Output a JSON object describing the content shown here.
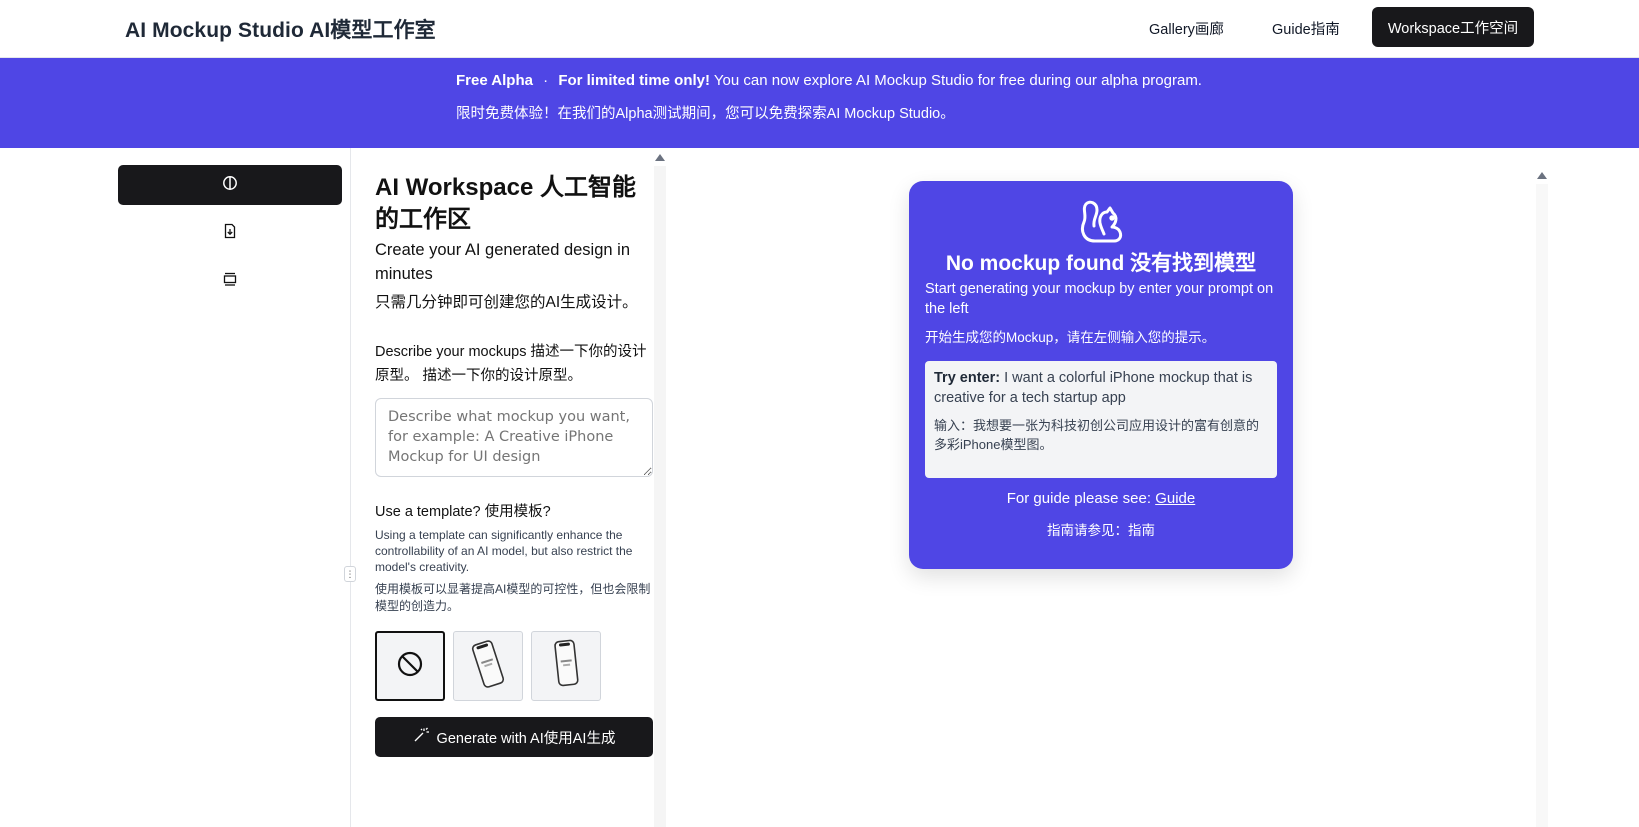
{
  "header": {
    "brand": "AI Mockup Studio AI模型工作室",
    "nav": {
      "gallery": "Gallery画廊",
      "guide": "Guide指南",
      "workspace": "Workspace工作空间"
    }
  },
  "banner": {
    "tag": "Free Alpha",
    "separator": "·",
    "highlight": "For limited time only!",
    "message": "You can now explore AI Mockup Studio for free during our alpha program.",
    "message_cn": "限时免费体验！在我们的Alpha测试期间，您可以免费探索AI Mockup Studio。"
  },
  "sidebar": {
    "items": [
      {
        "icon": "contrast-icon",
        "active": true
      },
      {
        "icon": "file-download-icon",
        "active": false
      },
      {
        "icon": "gallery-icon",
        "active": false
      }
    ]
  },
  "workspace": {
    "title": "AI Workspace 人工智能的工作区",
    "subtitle": "Create your AI generated design in minutes",
    "subtitle_cn": "只需几分钟即可创建您的AI生成设计。",
    "prompt_label": "Describe your mockups 描述一下你的设计原型。 描述一下你的设计原型。",
    "prompt_placeholder": "Describe what mockup you want, for example: A Creative iPhone Mockup for UI design",
    "template_label": "Use a template? 使用模板?",
    "template_desc": "Using a template can significantly enhance the controllability of an AI model, but also restrict the model's creativity.",
    "template_desc_cn": "使用模板可以显著提高AI模型的可控性，但也会限制模型的创造力。",
    "templates": [
      {
        "name": "no-template-icon",
        "selected": true
      },
      {
        "name": "iphone-tilted-template",
        "selected": false
      },
      {
        "name": "iphone-standing-template",
        "selected": false
      }
    ],
    "generate_label": "Generate with AI使用AI生成"
  },
  "empty_state": {
    "title": "No mockup found 没有找到模型",
    "subtitle": "Start generating your mockup by enter your prompt on the left",
    "subtitle_cn": "开始生成您的Mockup，请在左侧输入您的提示。",
    "try_label": "Try enter:",
    "try_text": "I want a colorful iPhone mockup that is creative for a tech startup app",
    "try_text_cn": "输入：我想要一张为科技初创公司应用设计的富有创意的多彩iPhone模型图。",
    "guide_prefix": "For guide please see:",
    "guide_link": "Guide",
    "guide_cn": "指南请参见：指南"
  },
  "colors": {
    "accent": "#4f46e5",
    "dark": "#18181b"
  }
}
